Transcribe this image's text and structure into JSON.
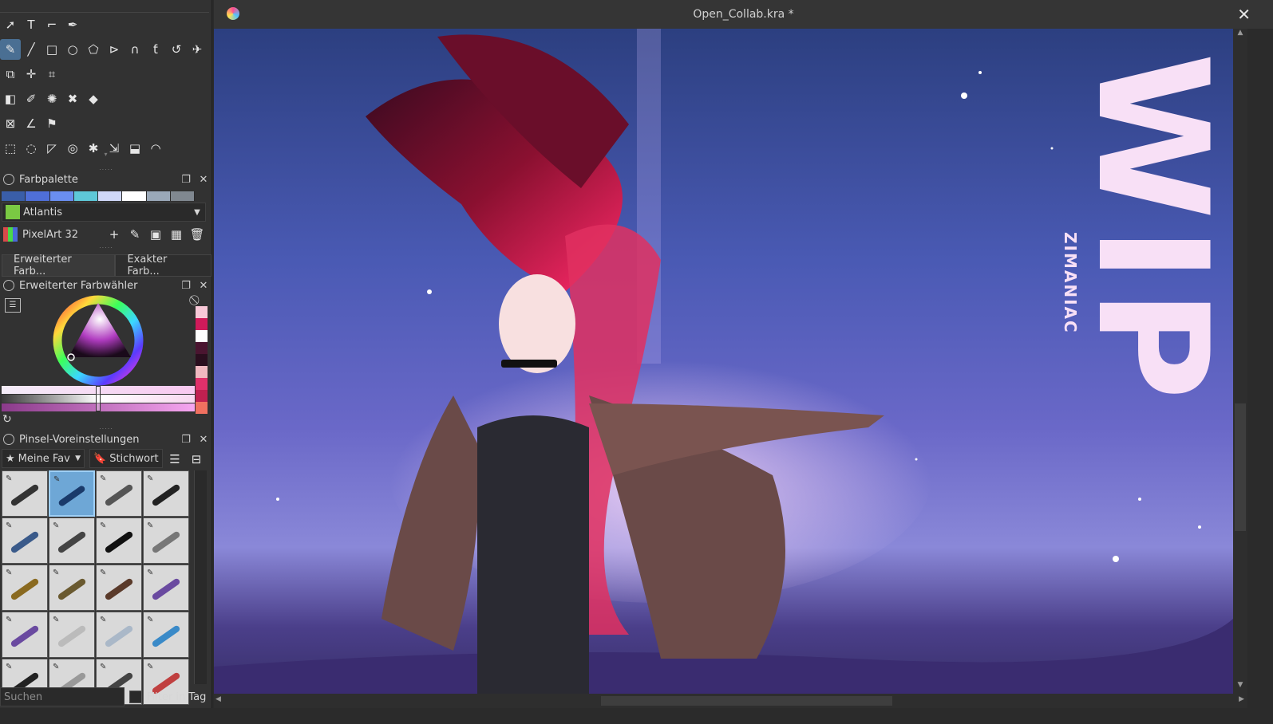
{
  "window": {
    "title": "Open_Collab.kra *",
    "close_glyph": "✕"
  },
  "toolbox": {
    "rows": [
      [
        "select-icon",
        "text-icon",
        "shape-edit-icon",
        "calligraphy-icon"
      ],
      [
        "freehand-brush-icon",
        "line-icon",
        "rectangle-icon",
        "ellipse-icon",
        "polygon-icon",
        "polyline-icon",
        "bezier-icon",
        "freehand-path-icon",
        "dynamic-brush-icon",
        "multibrush-icon"
      ],
      [
        "transform-icon",
        "move-icon",
        "crop-icon"
      ],
      [
        "gradient-icon",
        "color-picker-icon",
        "smart-patch-icon",
        "fill-icon",
        "enclosed-fill-icon"
      ],
      [
        "assistant-icon",
        "measure-icon",
        "reference-icon"
      ],
      [
        "rect-select-icon",
        "ellipse-select-icon",
        "polygon-select-icon",
        "freehand-select-icon",
        "contiguous-select-icon",
        "similar-select-icon",
        "bezier-select-icon",
        "magnetic-select-icon"
      ]
    ],
    "glyphs": {
      "select-icon": "➚",
      "text-icon": "T",
      "shape-edit-icon": "⌐",
      "calligraphy-icon": "✒",
      "freehand-brush-icon": "✎",
      "line-icon": "╱",
      "rectangle-icon": "□",
      "ellipse-icon": "○",
      "polygon-icon": "⬠",
      "polyline-icon": "⊳",
      "bezier-icon": "∩",
      "freehand-path-icon": "ƭ",
      "dynamic-brush-icon": "↺",
      "multibrush-icon": "✈",
      "transform-icon": "⧉",
      "move-icon": "✛",
      "crop-icon": "⌗",
      "gradient-icon": "◧",
      "color-picker-icon": "✐",
      "smart-patch-icon": "✺",
      "fill-icon": "✖",
      "enclosed-fill-icon": "◆",
      "assistant-icon": "⊠",
      "measure-icon": "∠",
      "reference-icon": "⚑",
      "rect-select-icon": "⬚",
      "ellipse-select-icon": "◌",
      "polygon-select-icon": "◸",
      "freehand-select-icon": "◎",
      "contiguous-select-icon": "✱",
      "similar-select-icon": "⇲",
      "bezier-select-icon": "⬓",
      "magnetic-select-icon": "◠"
    }
  },
  "palette": {
    "title": "Farbpalette",
    "swatches": [
      "#3a5ea8",
      "#4f6fd8",
      "#6a8ef0",
      "#5ec8d8",
      "#d0d8f8",
      "#ffffff",
      "#9aa8b8",
      "#808890"
    ],
    "selected_color_name": "Atlantis",
    "selected_color": "#7ac943",
    "palette_name": "PixelArt 32"
  },
  "color_tabs": [
    "Erweiterter Farb...",
    "Exakter Farb..."
  ],
  "color_selector": {
    "title": "Erweiterter Farbwähler",
    "recent_colors": [
      "#f8c8d8",
      "#d01a5a",
      "#ffffff",
      "#4a1530",
      "#2a0e1e",
      "#f0b8c0",
      "#e0306a",
      "#c02050",
      "#f07060"
    ]
  },
  "brush_presets": {
    "title": "Pinsel-Voreinstellungen",
    "tag_filter": "Meine Fav",
    "tag_label": "Stichwort",
    "search_placeholder": "Suchen",
    "filter_in_tag": "Filter in Tag",
    "count": 20
  },
  "canvas": {
    "watermark_big": "WIP",
    "watermark_small": "ZIMANIAC"
  }
}
